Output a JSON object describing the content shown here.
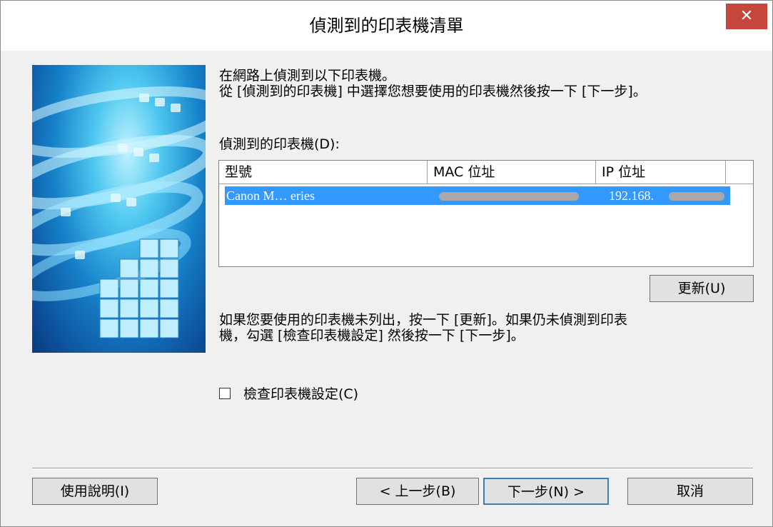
{
  "window": {
    "title": "偵測到的印表機清單",
    "close_glyph": "✕"
  },
  "instructions": {
    "line1": "在網路上偵測到以下印表機。",
    "line2": "從 [偵測到的印表機] 中選擇您想要使用的印表機然後按一下 [下一步]。"
  },
  "printer_list": {
    "label": "偵測到的印表機(D):",
    "columns": [
      "型號",
      "MAC 位址",
      "IP 位址"
    ],
    "rows": [
      {
        "model": "Canon M… eries",
        "mac": "",
        "ip": "192.168.",
        "selected": true
      }
    ]
  },
  "refresh_button": "更新(U)",
  "note": {
    "line1": "如果您要使用的印表機未列出，按一下 [更新]。如果仍未偵測到印表",
    "line2": "機，勾選 [檢查印表機設定] 然後按一下 [下一步]。"
  },
  "check_settings": {
    "label": "檢查印表機設定(C)",
    "checked": false
  },
  "buttons": {
    "help": "使用說明(I)",
    "back": "< 上一步(B)",
    "next": "下一步(N) >",
    "cancel": "取消"
  },
  "colors": {
    "close_button": "#c7463b",
    "selection": "#3399ff",
    "dialog_background": "#f0f0f0"
  }
}
